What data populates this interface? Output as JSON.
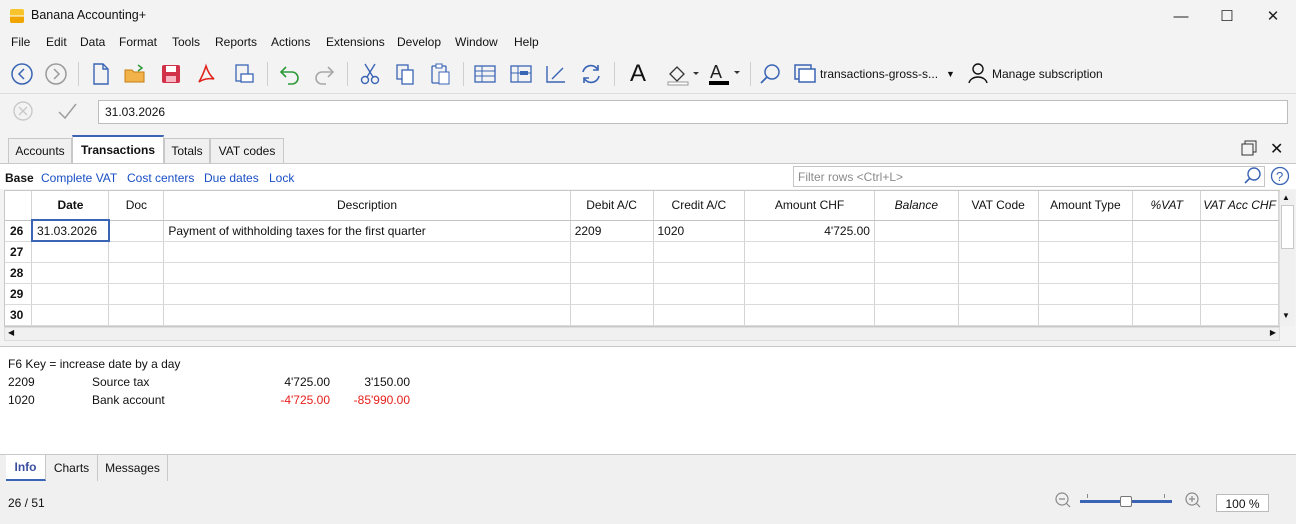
{
  "app": {
    "title": "Banana Accounting+",
    "accent": "#3a64b4",
    "minimize_label": "—",
    "maximize_label": "☐",
    "close_label": "✕"
  },
  "menu": [
    "File",
    "Edit",
    "Data",
    "Format",
    "Tools",
    "Reports",
    "Actions",
    "Extensions",
    "Develop",
    "Window",
    "Help"
  ],
  "toolbar": {
    "layout_label": "transactions-gross-s...",
    "subscription_label": "Manage subscription"
  },
  "editline": {
    "cell_value": "31.03.2026"
  },
  "tabs": [
    "Accounts",
    "Transactions",
    "Totals",
    "VAT codes"
  ],
  "views": {
    "base": "Base",
    "links": [
      "Complete VAT",
      "Cost centers",
      "Due dates",
      "Lock"
    ],
    "filter_placeholder": "Filter rows <Ctrl+L>"
  },
  "grid": {
    "columns": [
      "",
      "Date",
      "Doc",
      "Description",
      "Debit A/C",
      "Credit A/C",
      "Amount CHF",
      "Balance",
      "VAT Code",
      "Amount Type",
      "%VAT",
      "VAT Acc CHF"
    ],
    "rows": [
      [
        "26",
        "31.03.2026",
        "",
        "Payment of withholding taxes for the first quarter",
        "2209",
        "1020",
        "4'725.00",
        "",
        "",
        "",
        "",
        ""
      ],
      [
        "27",
        "",
        "",
        "",
        "",
        "",
        "",
        "",
        "",
        "",
        "",
        ""
      ],
      [
        "28",
        "",
        "",
        "",
        "",
        "",
        "",
        "",
        "",
        "",
        "",
        ""
      ],
      [
        "29",
        "",
        "",
        "",
        "",
        "",
        "",
        "",
        "",
        "",
        "",
        ""
      ],
      [
        "30",
        "",
        "",
        "",
        "",
        "",
        "",
        "",
        "",
        "",
        "",
        ""
      ]
    ]
  },
  "info": {
    "hint": "F6 Key = increase date by a day",
    "lines": [
      {
        "account": "2209",
        "name": "Source tax",
        "amount": "4'725.00",
        "balance": "3'150.00"
      },
      {
        "account": "1020",
        "name": "Bank account",
        "amount": "-4'725.00",
        "balance": "-85'990.00"
      }
    ]
  },
  "bottom_tabs": [
    "Info",
    "Charts",
    "Messages"
  ],
  "status": {
    "position": "26 / 51",
    "zoom": "100 %",
    "zoom_level": 1.0
  }
}
